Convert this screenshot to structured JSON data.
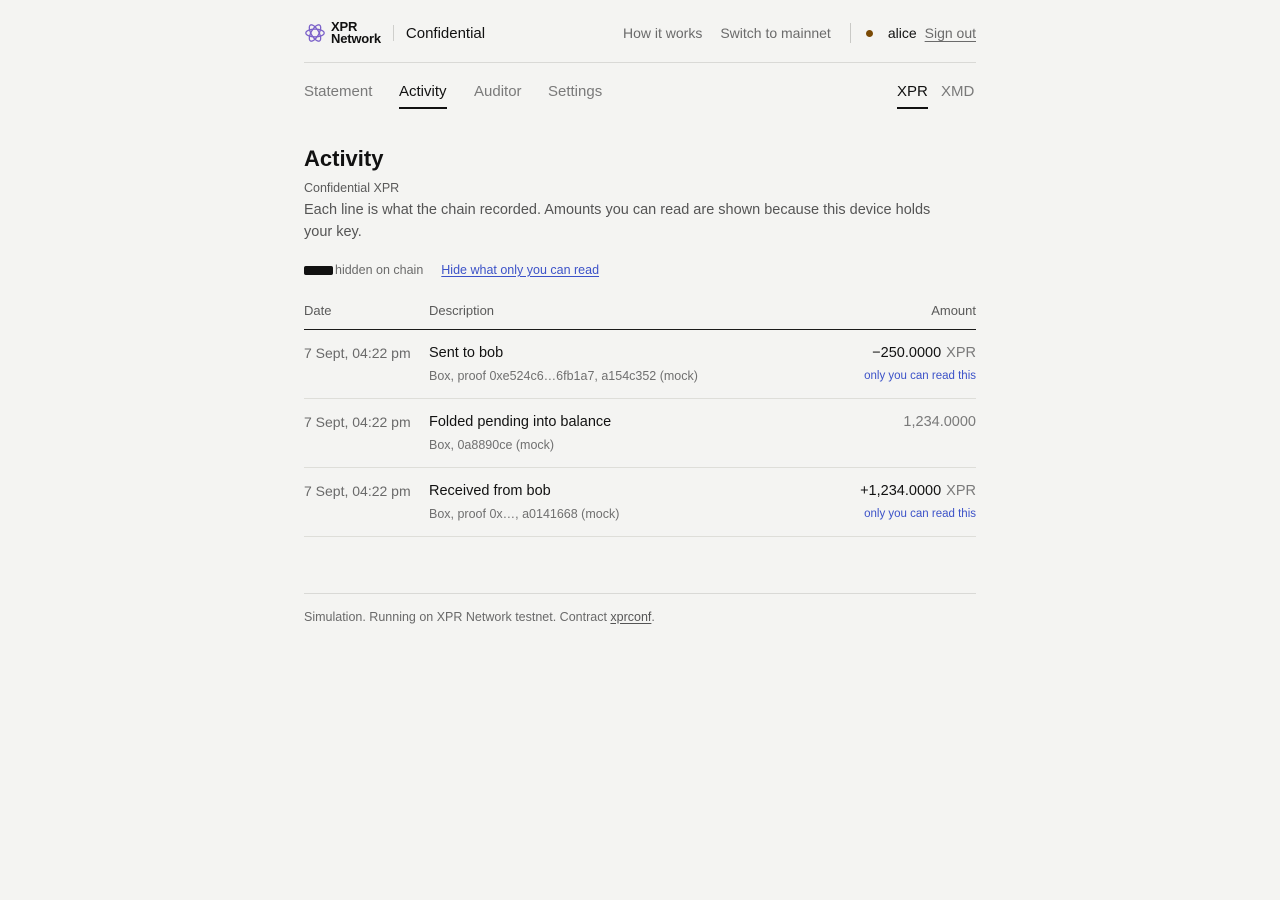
{
  "header": {
    "logo": {
      "line1": "XPR",
      "line2": "Network",
      "icon": "xpr-logo-icon",
      "color": "#7b61c9"
    },
    "brand_name": "Confidential",
    "links": [
      "How it works",
      "Switch to mainnet"
    ],
    "status_dot_color": "#7a4a06",
    "user": "alice",
    "sign_out": "Sign out"
  },
  "tabs": {
    "items": [
      "Statement",
      "Activity",
      "Auditor",
      "Settings"
    ],
    "active": "Activity",
    "tokens": [
      "XPR",
      "XMD"
    ],
    "active_token": "XPR"
  },
  "page": {
    "title": "Activity",
    "subtitle": "Confidential XPR",
    "description": "Each line is what the chain recorded. Amounts you can read are shown because this device holds your key.",
    "legend_label": "hidden on chain",
    "toggle_link": "Hide what only you can read"
  },
  "table": {
    "headers": {
      "date": "Date",
      "description": "Description",
      "amount": "Amount"
    },
    "rows": [
      {
        "date": "7 Sept, 04:22 pm",
        "title": "Sent to bob",
        "detail": "Box, proof 0xe524c6…6fb1a7, a154c352 (mock)",
        "amount": "−250.0000",
        "unit": "XPR",
        "note": "only you can read this"
      },
      {
        "date": "7 Sept, 04:22 pm",
        "title": "Folded pending into balance",
        "detail": "Box, 0a8890ce (mock)",
        "amount": "1,234.0000",
        "unit": "",
        "note": ""
      },
      {
        "date": "7 Sept, 04:22 pm",
        "title": "Received from bob",
        "detail": "Box, proof 0x…, a0141668 (mock)",
        "amount": "+1,234.0000",
        "unit": "XPR",
        "note": "only you can read this"
      }
    ]
  },
  "footer": {
    "text": "Simulation. Running on XPR Network testnet. Contract ",
    "contract": "xprconf",
    "end": "."
  }
}
